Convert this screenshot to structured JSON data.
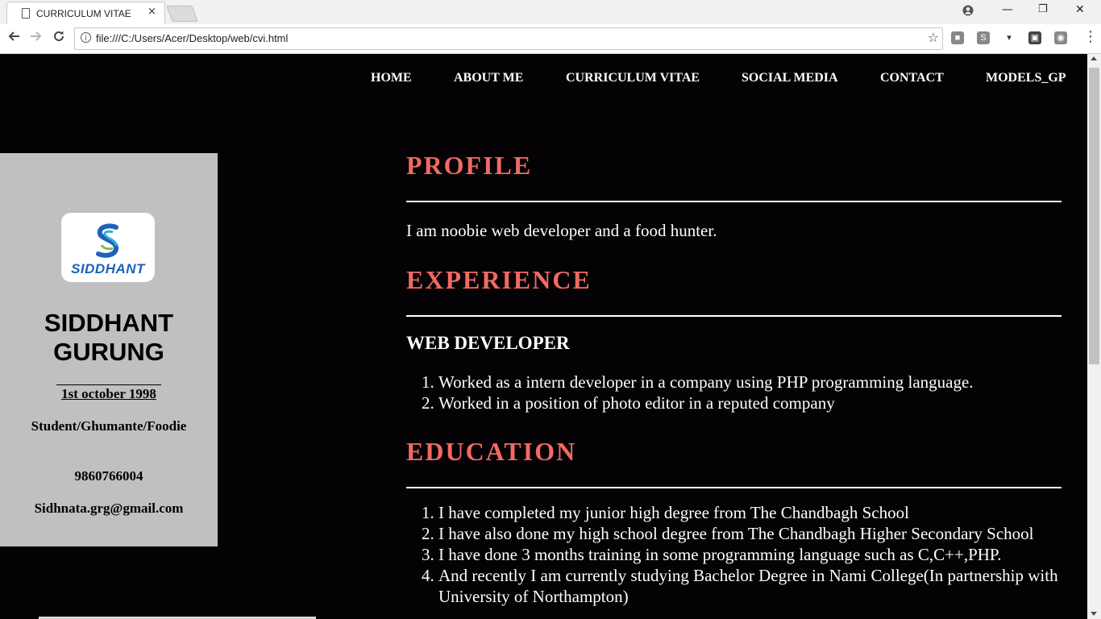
{
  "browser": {
    "tab_title": "CURRICULUM VITAE",
    "tab_close": "×",
    "url": "file:///C:/Users/Acer/Desktop/web/cvi.html",
    "window_controls": {
      "minimize": "—",
      "restore": "❐",
      "close": "✕"
    },
    "icons": [
      "back-icon",
      "forward-icon",
      "reload-icon",
      "info-icon",
      "star-icon",
      "account-icon",
      "menu-icon"
    ]
  },
  "nav": {
    "items": [
      "HOME",
      "ABOUT ME",
      "CURRICULUM VITAE",
      "SOCIAL MEDIA",
      "CONTACT",
      "MODELS_GP"
    ]
  },
  "sidebar": {
    "logo_text": "SIDDHANT",
    "name_first": "SIDDHANT",
    "name_last": "GURUNG",
    "dob": "1st october 1998",
    "tagline": "Student/Ghumante/Foodie",
    "phone": "9860766004",
    "email": "Sidhnata.grg@gmail.com"
  },
  "profile": {
    "title": "PROFILE",
    "text": "I am noobie web developer and a food hunter."
  },
  "experience": {
    "title": "EXPERIENCE",
    "role": "WEB DEVELOPER",
    "items": [
      "Worked as a intern developer in a company using PHP programming language.",
      "Worked in a position of photo editor in a reputed company"
    ]
  },
  "education": {
    "title": "EDUCATION",
    "items": [
      "I have completed my junior high degree from The Chandbagh School",
      "I have also done my high school degree from The Chandbagh Higher Secondary School",
      "I have done 3 months training in some programming language such as C,C++,PHP.",
      "And recently I am currently studying Bachelor Degree in Nami College(In partnership with University of Northampton)"
    ]
  },
  "colors": {
    "page_bg": "#040204",
    "sidebar_bg": "#c0c0c0",
    "heading_accent": "#f06a63",
    "text": "#ffffff"
  }
}
